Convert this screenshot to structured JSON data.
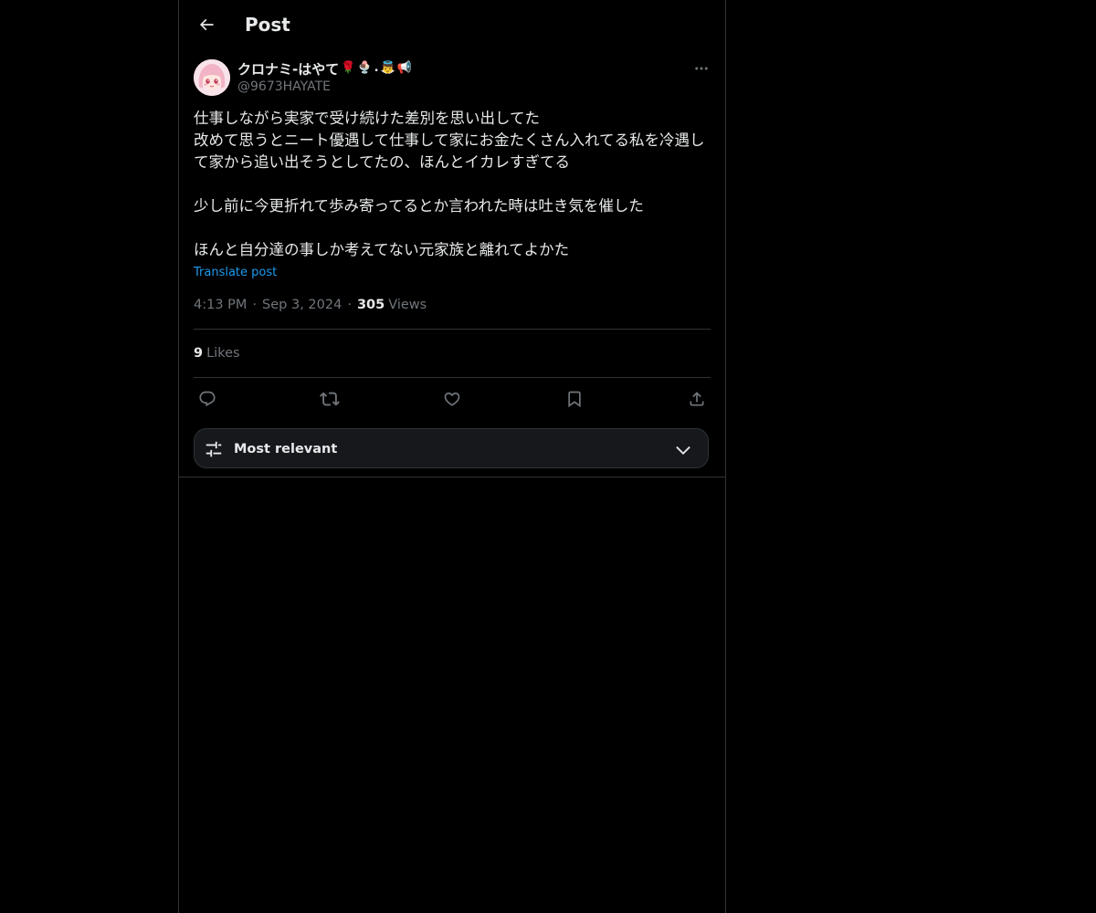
{
  "header": {
    "title": "Post",
    "back_icon": "arrow-left-icon"
  },
  "author": {
    "display_name": "クロナミ-はやて",
    "name_emojis": [
      "🌹",
      "🍨",
      ".",
      "👼",
      "📢"
    ],
    "handle": "@9673HAYATE",
    "avatar_icon": "anime-girl-avatar"
  },
  "post": {
    "text": "仕事しながら実家で受け続けた差別を思い出してた\n改めて思うとニート優遇して仕事して家にお金たくさん入れてる私を冷遇して家から追い出そうとしてたの、ほんとイカレすぎてる\n\n少し前に今更折れて歩み寄ってるとか言われた時は吐き気を催した\n\nほんと自分達の事しか考えてない元家族と離れてよかた",
    "translate_label": "Translate post",
    "time": "4:13 PM",
    "separator": "·",
    "date": "Sep 3, 2024",
    "views_count": "305",
    "views_label": "Views"
  },
  "likes": {
    "count": "9",
    "label": "Likes"
  },
  "actions": [
    {
      "name": "reply",
      "icon": "reply-icon"
    },
    {
      "name": "repost",
      "icon": "repost-icon"
    },
    {
      "name": "like",
      "icon": "heart-icon"
    },
    {
      "name": "bookmark",
      "icon": "bookmark-icon"
    },
    {
      "name": "share",
      "icon": "share-icon"
    }
  ],
  "sort": {
    "label": "Most relevant",
    "icon": "sliders-icon",
    "chevron_icon": "chevron-down-icon"
  },
  "colors": {
    "background": "#000000",
    "text": "#e7e9ea",
    "secondary": "#71767b",
    "link": "#1d9bf0",
    "border": "#2f3336"
  }
}
